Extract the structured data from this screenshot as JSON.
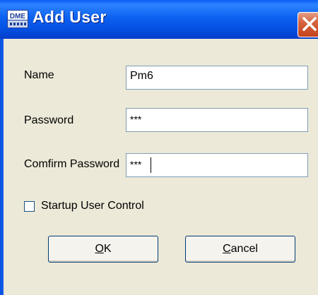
{
  "window": {
    "title": "Add User",
    "app_icon_text": "DME",
    "close_icon": "close-icon"
  },
  "form": {
    "name_label": "Name",
    "name_value": "Pm6",
    "password_label": "Password",
    "password_value": "***",
    "confirm_label": "Comfirm Password",
    "confirm_value": "***",
    "startup_label": "Startup User Control",
    "startup_checked": false
  },
  "buttons": {
    "ok_first": "O",
    "ok_rest": "K",
    "cancel_first": "C",
    "cancel_rest": "ancel"
  },
  "colors": {
    "titlebar": "#0550E3",
    "close": "#D6633F",
    "dialog_bg": "#ECE9D8"
  }
}
